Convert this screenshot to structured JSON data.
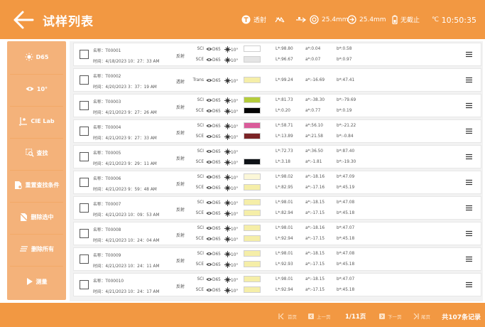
{
  "header": {
    "title": "试样列表",
    "mode": "透射",
    "aperture_left": "25.4mm",
    "aperture_right": "25.4mm",
    "status": "无截止",
    "temp_unit": "℃",
    "time": "10:50:35",
    "colors": {
      "bg": "#f29842",
      "text": "#ffffff"
    }
  },
  "sidebar": [
    {
      "label": "D65",
      "icon": "sun-icon"
    },
    {
      "label": "10°",
      "icon": "eye-icon"
    },
    {
      "label": "CIE Lab",
      "icon": "color-space-icon"
    },
    {
      "label": "查找",
      "icon": "search-icon"
    },
    {
      "label": "重置查找条件",
      "icon": "reset-search-icon"
    },
    {
      "label": "删除选中",
      "icon": "delete-selected-icon"
    },
    {
      "label": "删除所有",
      "icon": "delete-all-icon"
    },
    {
      "label": "测量",
      "icon": "play-icon"
    }
  ],
  "rows": [
    {
      "name": "名称：T00001",
      "time": "时间：4/18/2023 10：27：33 AM",
      "mode": "反射",
      "lines": [
        {
          "type": "SCI",
          "ill": "D65",
          "obs": "10°",
          "color": "#ffffff",
          "L": "L*:98.80",
          "a": "a*:0.04",
          "b": "b*:0.58"
        },
        {
          "type": "SCE",
          "ill": "D65",
          "obs": "10°",
          "color": "#e5e5e5",
          "L": "L*:96.67",
          "a": "a*:0.07",
          "b": "b*:0.97"
        }
      ]
    },
    {
      "name": "名称：T00002",
      "time": "时间：4/20/2023 3：37：19 AM",
      "mode": "透射",
      "lines": [
        {
          "type": "Trans",
          "ill": "D65",
          "obs": "10°",
          "color": "#f5eea8",
          "L": "L*:99.24",
          "a": "a*:-16.69",
          "b": "b*:47.41"
        }
      ]
    },
    {
      "name": "名称：T00003",
      "time": "时间：4/21/2023 9：27：26 AM",
      "mode": "反射",
      "lines": [
        {
          "type": "SCI",
          "ill": "D65",
          "obs": "10°",
          "color": "#b4cc3b",
          "L": "L*:81.73",
          "a": "a*:-38.30",
          "b": "b*:-79.69"
        },
        {
          "type": "SCE",
          "ill": "D65",
          "obs": "10°",
          "color": "#050505",
          "L": "L*:0.20",
          "a": "a*:0.77",
          "b": "b*:0.19"
        }
      ]
    },
    {
      "name": "名称：T00004",
      "time": "时间：4/21/2023 9：27：33 AM",
      "mode": "反射",
      "lines": [
        {
          "type": "SCI",
          "ill": "D65",
          "obs": "10°",
          "color": "#da5b9a",
          "L": "L*:58.71",
          "a": "a*:56.10",
          "b": "b*:-21.22"
        },
        {
          "type": "SCE",
          "ill": "D65",
          "obs": "10°",
          "color": "#7b2326",
          "L": "L*:13.89",
          "a": "a*:21.58",
          "b": "b*:-0.84"
        }
      ]
    },
    {
      "name": "名称：T00005",
      "time": "时间：4/21/2023 9：29：11 AM",
      "mode": "反射",
      "lines": [
        {
          "type": "SCI",
          "ill": "D65",
          "obs": "10°",
          "color": "",
          "L": "L*:72.73",
          "a": "a*:36.50",
          "b": "b*:87.40"
        },
        {
          "type": "SCE",
          "ill": "D65",
          "obs": "10°",
          "color": "#0e1217",
          "L": "L*:3.18",
          "a": "a*:-1.81",
          "b": "b*:-19.30"
        }
      ]
    },
    {
      "name": "名称：T00006",
      "time": "时间：4/21/2023 9：59：48 AM",
      "mode": "反射",
      "lines": [
        {
          "type": "SCI",
          "ill": "D65",
          "obs": "10°",
          "color": "#fbf7d8",
          "L": "L*:98.02",
          "a": "a*:-18.16",
          "b": "b*:47.09"
        },
        {
          "type": "SCE",
          "ill": "D65",
          "obs": "10°",
          "color": "#f5eea8",
          "L": "L*:82.95",
          "a": "a*:-17.16",
          "b": "b*:45.19"
        }
      ]
    },
    {
      "name": "名称：T00007",
      "time": "时间：4/21/2023 10：09：53 AM",
      "mode": "反射",
      "lines": [
        {
          "type": "SCI",
          "ill": "D65",
          "obs": "10°",
          "color": "#f5eea8",
          "L": "L*:98.01",
          "a": "a*:-18.15",
          "b": "b*:47.08"
        },
        {
          "type": "SCE",
          "ill": "D65",
          "obs": "10°",
          "color": "#f5eea8",
          "L": "L*:82.94",
          "a": "a*:-17.15",
          "b": "b*:45.18"
        }
      ]
    },
    {
      "name": "名称：T00008",
      "time": "时间：4/21/2023 10：24：04 AM",
      "mode": "反射",
      "lines": [
        {
          "type": "SCI",
          "ill": "D65",
          "obs": "10°",
          "color": "#f5eea8",
          "L": "L*:98.01",
          "a": "a*:-18.16",
          "b": "b*:47.07"
        },
        {
          "type": "SCE",
          "ill": "D65",
          "obs": "10°",
          "color": "#f5eea8",
          "L": "L*:92.94",
          "a": "a*:-17.15",
          "b": "b*:45.18"
        }
      ]
    },
    {
      "name": "名称：T00009",
      "time": "时间：4/21/2023 10：24：11 AM",
      "mode": "反射",
      "lines": [
        {
          "type": "SCI",
          "ill": "D65",
          "obs": "10°",
          "color": "#f5eea8",
          "L": "L*:98.01",
          "a": "a*:-18.15",
          "b": "b*:47.08"
        },
        {
          "type": "SCE",
          "ill": "D65",
          "obs": "10°",
          "color": "#f5eea8",
          "L": "L*:92.93",
          "a": "a*:-17.15",
          "b": "b*:45.18"
        }
      ]
    },
    {
      "name": "名称：T000010",
      "time": "时间：4/21/2023 10：24：17 AM",
      "mode": "反射",
      "lines": [
        {
          "type": "SCI",
          "ill": "D65",
          "obs": "10°",
          "color": "#f5eea8",
          "L": "L*:98.01",
          "a": "a*:-18.15",
          "b": "b*:47.07"
        },
        {
          "type": "SCE",
          "ill": "D65",
          "obs": "10°",
          "color": "#f5eea8",
          "L": "L*:92.94",
          "a": "a*:-17.15",
          "b": "b*:45.18"
        }
      ]
    }
  ],
  "footer": {
    "first": "首页",
    "prev": "上一页",
    "page": "1/11页",
    "next": "下一页",
    "last": "尾页",
    "total": "共107条记录"
  }
}
